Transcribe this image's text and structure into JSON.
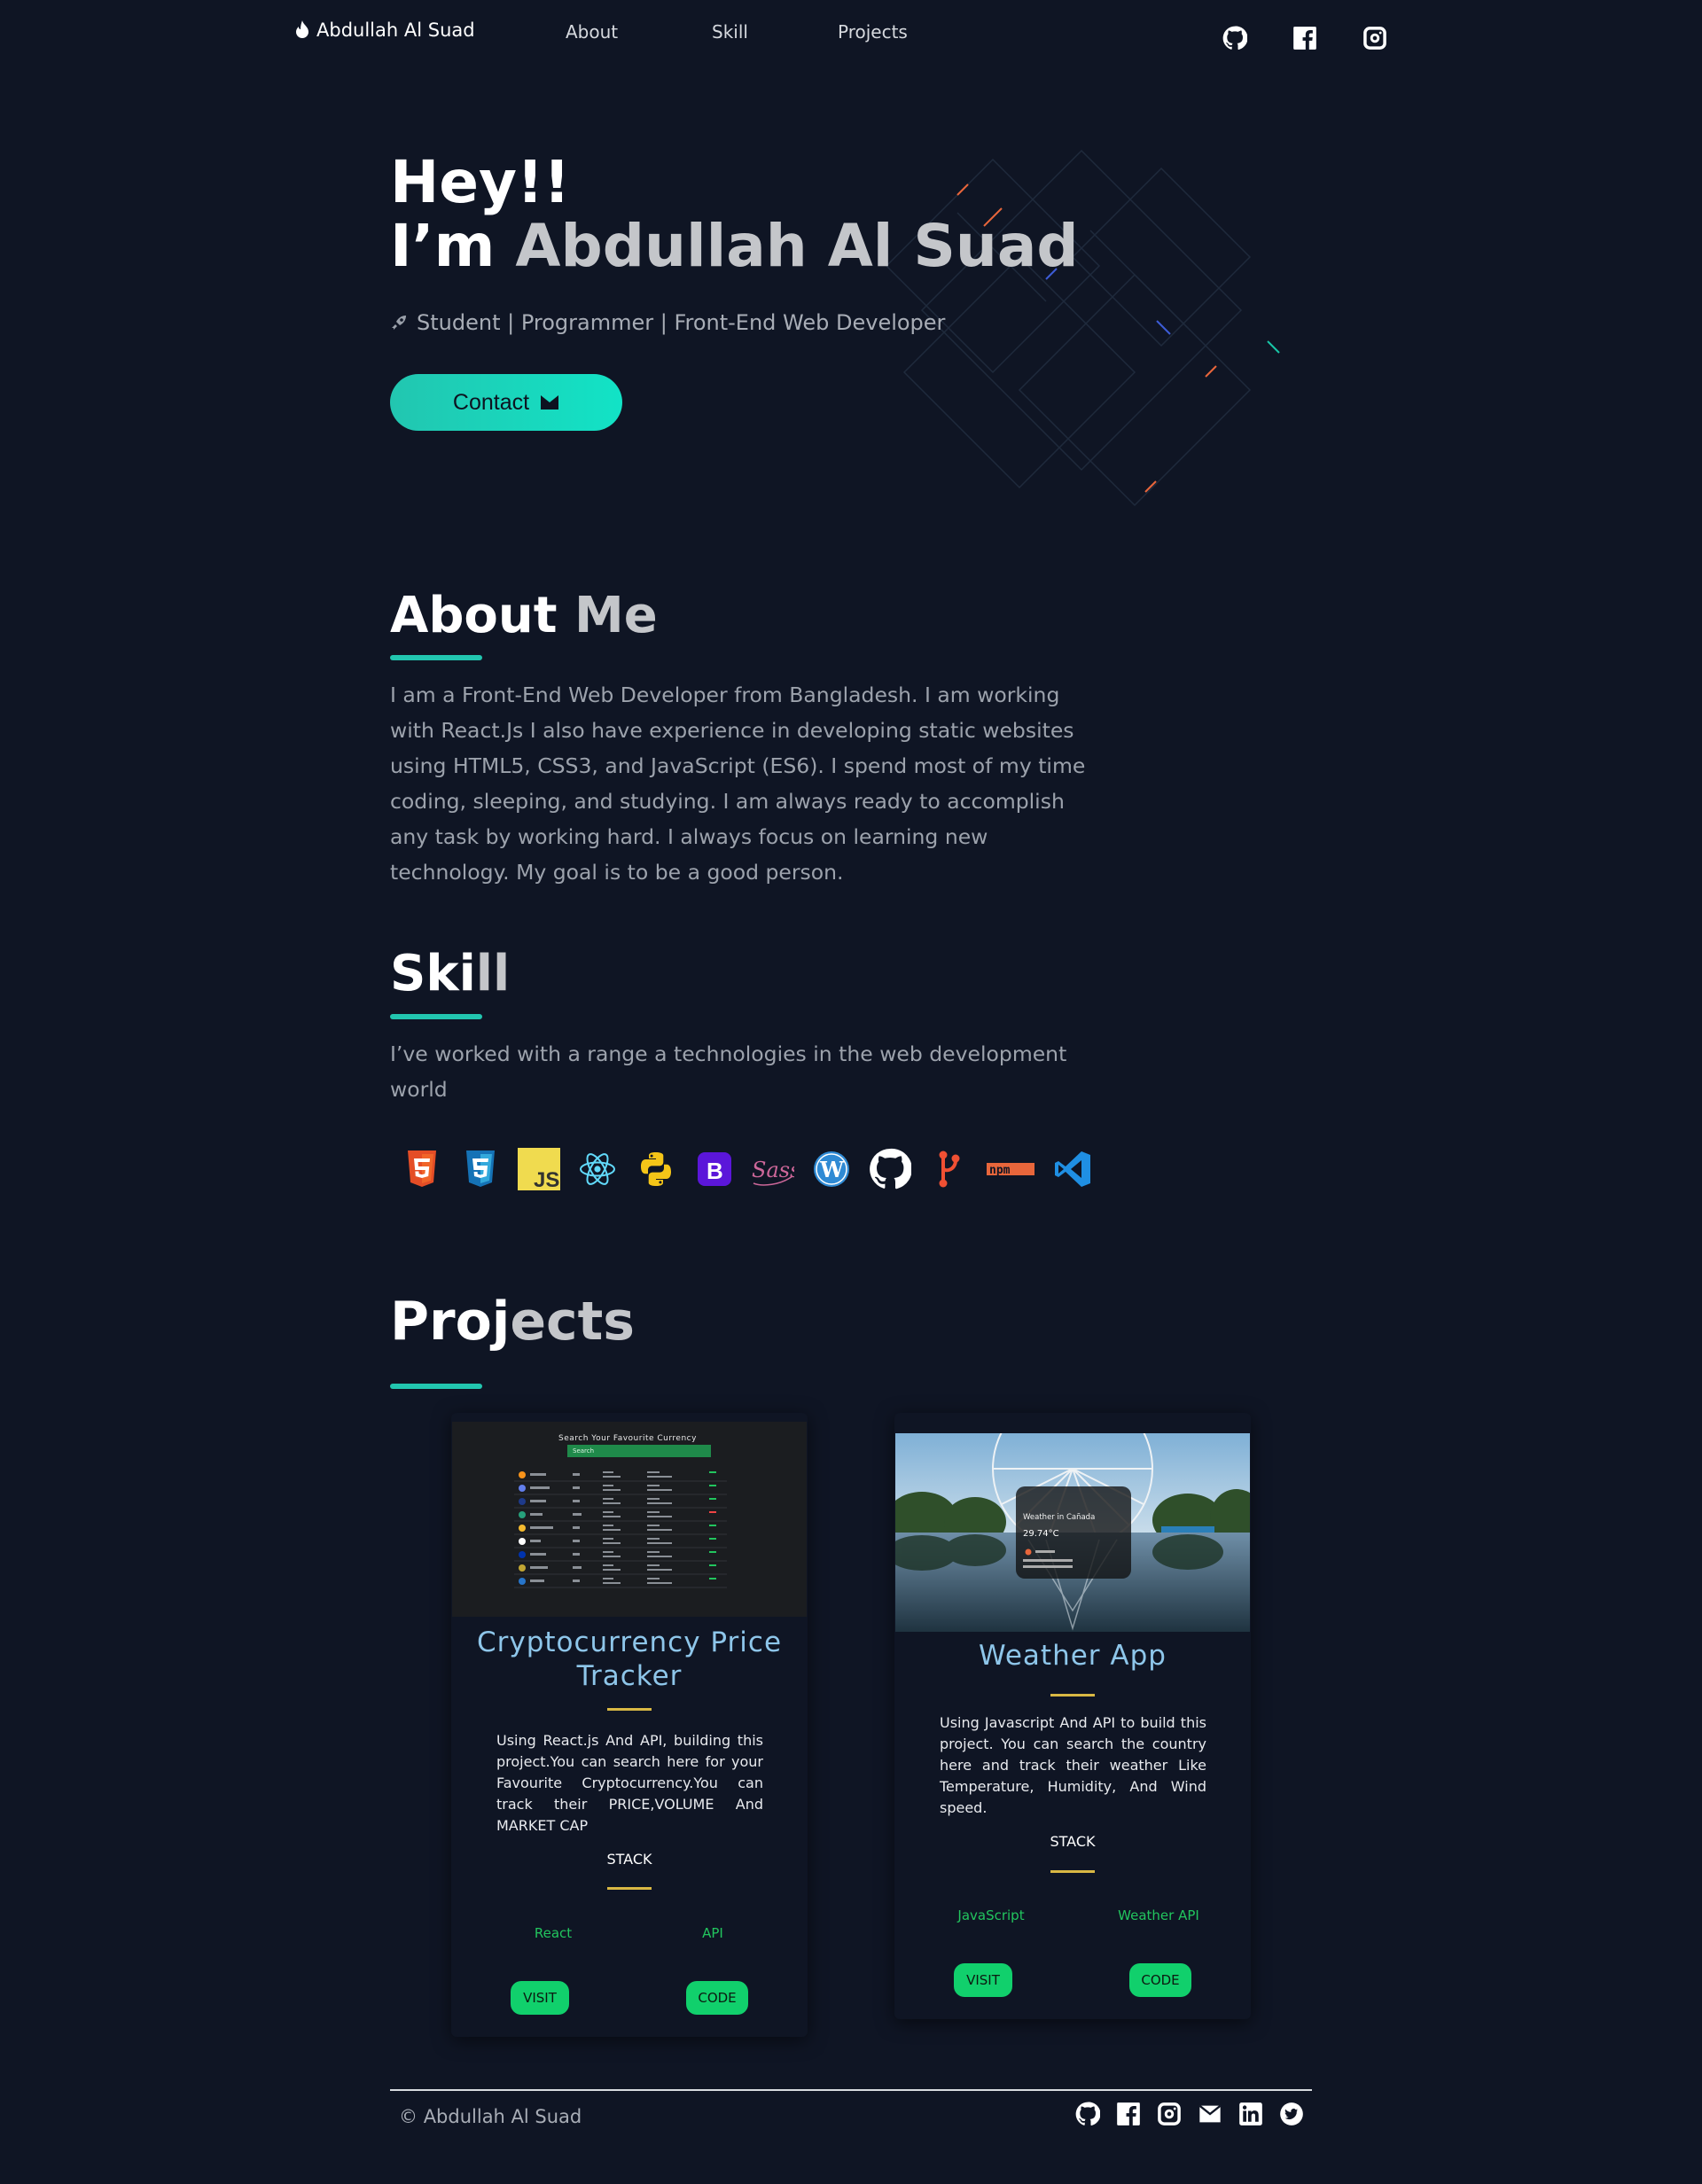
{
  "nav": {
    "brand": "Abdullah Al Suad",
    "links": [
      "About",
      "Skill",
      "Projects"
    ],
    "icons": [
      "github-icon",
      "facebook-icon",
      "instagram-icon"
    ]
  },
  "hero": {
    "greeting": "Hey!!",
    "intro_prefix": "I’m ",
    "name": "Abdullah Al Suad",
    "tagline": "Student | Programmer | Front-End Web Developer",
    "contact_label": "Contact"
  },
  "about": {
    "title_a": "About",
    "title_b": " Me",
    "text": "I am a Front-End Web Developer from Bangladesh. I am working with React.Js I also have experience in developing static websites using HTML5, CSS3, and JavaScript (ES6). I spend most of my time coding, sleeping, and studying. I am always ready to accomplish any task by working hard. I always focus on learning new technology. My goal is to be a good person."
  },
  "skill": {
    "title_a": "Ski",
    "title_b": "ll",
    "text": "I’ve worked with a range a technologies in the web development world",
    "icons": [
      "html5-icon",
      "css3-icon",
      "javascript-icon",
      "react-icon",
      "python-icon",
      "bootstrap-icon",
      "sass-icon",
      "wordpress-icon",
      "github-icon",
      "git-icon",
      "npm-icon",
      "vscode-icon"
    ]
  },
  "projects": {
    "title_a": "Proj",
    "title_b": "ects",
    "cards": [
      {
        "title": "Cryptocurrency Price Tracker",
        "description": "Using React.js And API, building this project.You can search here for your Favourite Cryptocurrency.You can track their PRICE,VOLUME And MARKET CAP",
        "stack_label": "STACK",
        "tech": [
          "React",
          "API"
        ],
        "visit": "VISIT",
        "code": "CODE",
        "thumb_heading": "Search Your Favourite Currency",
        "thumb_search": "Search"
      },
      {
        "title": "Weather App",
        "description": "Using Javascript And API to build this project. You can search the country here and track their weather Like Temperature, Humidity, And Wind speed.",
        "stack_label": "STACK",
        "tech": [
          "JavaScript",
          "Weather API"
        ],
        "visit": "VISIT",
        "code": "CODE",
        "thumb_city": "Weather in Cañada",
        "thumb_temp": "29.74°C"
      }
    ]
  },
  "footer": {
    "copyright_symbol": "©",
    "name": "Abdullah Al Suad",
    "icons": [
      "github-icon",
      "facebook-icon",
      "instagram-icon",
      "mail-icon",
      "linkedin-icon",
      "twitter-icon"
    ]
  },
  "colors": {
    "background": "#0f1524",
    "accent": "#22c6b0",
    "card_title": "#8ec6ea",
    "gold": "#d9b844",
    "tech_green": "#22c55e",
    "button_green": "#11d06c"
  }
}
